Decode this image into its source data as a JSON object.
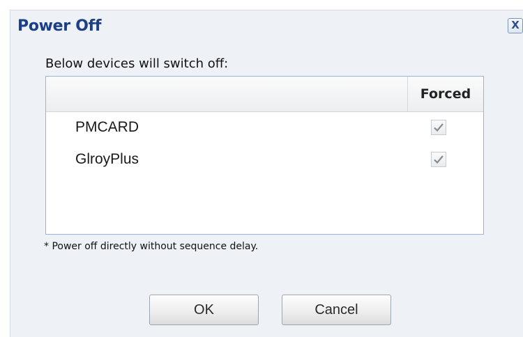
{
  "dialog": {
    "title": "Power Off",
    "close_label": "X",
    "subtitle": "Below devices will switch off:",
    "table": {
      "columns": [
        "",
        "Forced"
      ],
      "rows": [
        {
          "device": "PMCARD",
          "forced": true
        },
        {
          "device": "GlroyPlus",
          "forced": true
        }
      ]
    },
    "note": "* Power off directly without sequence delay.",
    "buttons": {
      "ok": "OK",
      "cancel": "Cancel"
    }
  },
  "colors": {
    "title": "#1c3f8a",
    "dialog_bg": "#eef1f6",
    "grid_border": "#99b4d8",
    "checkmark": "#8a8a8a"
  },
  "icons": {
    "close": "close-icon",
    "check": "checkmark-icon"
  }
}
